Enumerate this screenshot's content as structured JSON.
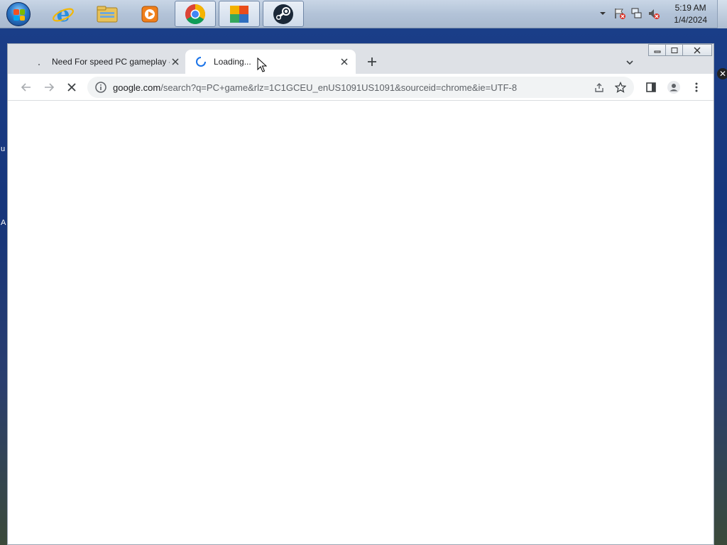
{
  "taskbar": {
    "pinned": [
      {
        "name": "start-orb-icon"
      },
      {
        "name": "internet-explorer-icon"
      },
      {
        "name": "file-explorer-icon"
      },
      {
        "name": "media-player-icon"
      },
      {
        "name": "chrome-icon",
        "active": true
      },
      {
        "name": "avg-antivirus-icon",
        "active": true
      },
      {
        "name": "steam-icon",
        "active": true
      }
    ],
    "tray": {
      "time": "5:19 AM",
      "date": "1/4/2024"
    }
  },
  "browser": {
    "tabs": [
      {
        "title": "Need For speed PC gameplay - G",
        "favicon": "google-icon",
        "active": false
      },
      {
        "title": "Loading...",
        "favicon": "loading-spinner-icon",
        "active": true
      }
    ],
    "omnibox": {
      "host": "google.com",
      "path": "/search?q=PC+game&rlz=1C1GCEU_enUS1091US1091&sourceid=chrome&ie=UTF-8"
    }
  },
  "desktop": {
    "edge_letters": [
      "u",
      "A"
    ]
  },
  "colors": {
    "taskbar": "#b3c3d8",
    "chrome_frame": "#dee1e6",
    "tab_active": "#ffffff",
    "omnibox_bg": "#f1f3f4",
    "spinner": "#1a73e8"
  }
}
